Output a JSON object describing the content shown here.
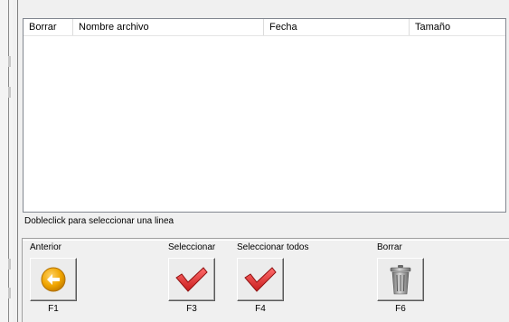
{
  "list": {
    "columns": [
      "Borrar",
      "Nombre archivo",
      "Fecha",
      "Tamaño"
    ],
    "rows": []
  },
  "status": "Dobleclick para seleccionar una linea",
  "buttons": [
    {
      "label": "Anterior",
      "key": "F1",
      "icon": "back-arrow-icon"
    },
    {
      "label": "Seleccionar",
      "key": "F3",
      "icon": "checkmark-icon"
    },
    {
      "label": "Seleccionar todos",
      "key": "F4",
      "icon": "checkmark-icon"
    },
    {
      "label": "Borrar",
      "key": "F6",
      "icon": "trash-can-icon"
    }
  ],
  "colors": {
    "back_arrow": "#f0a500",
    "checkmark": "#e03a3a",
    "trash": "#8a8a8a"
  }
}
